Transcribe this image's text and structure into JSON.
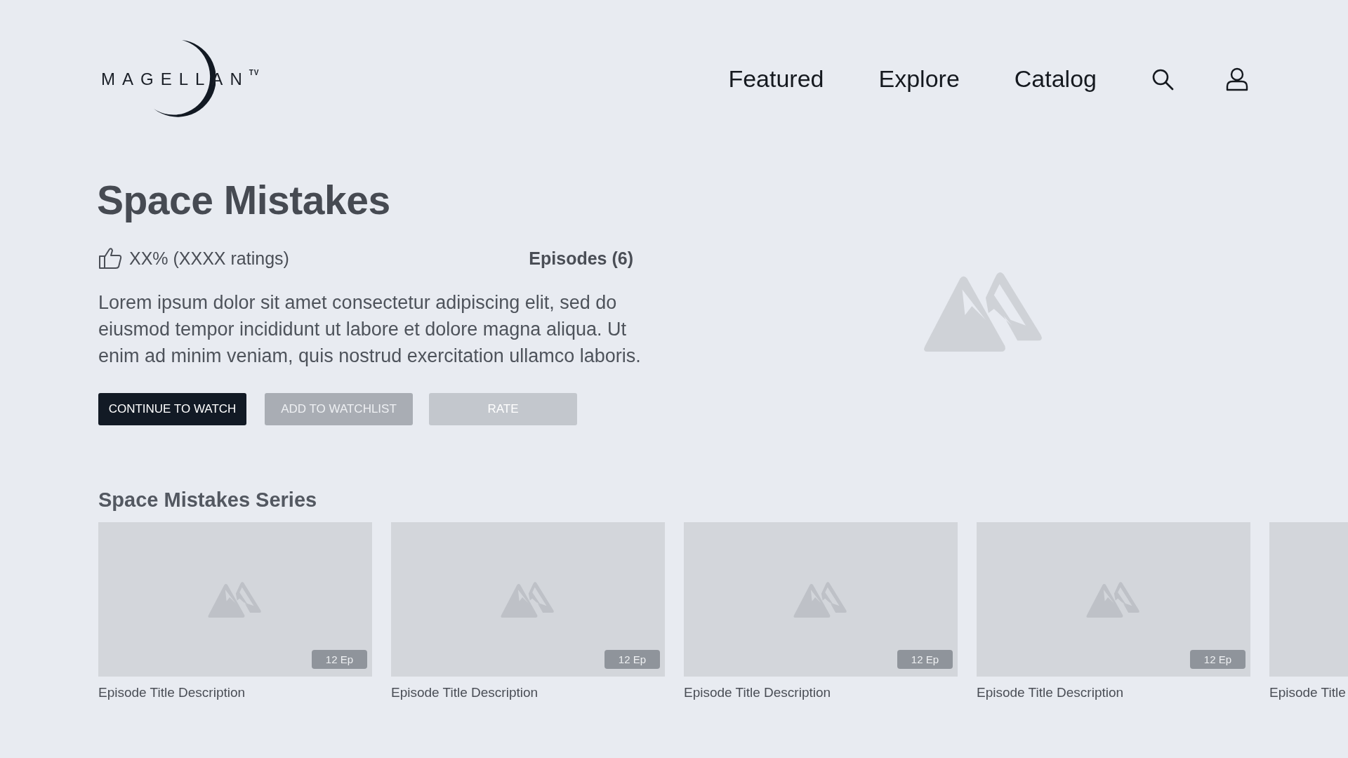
{
  "logo": {
    "text": "MAGELLAN$^{TV}$"
  },
  "nav": {
    "links": [
      {
        "label": "Featured"
      },
      {
        "label": "Explore"
      },
      {
        "label": "Catalog"
      }
    ]
  },
  "show": {
    "title": "Space Mistakes",
    "rating": "XX% (XXXX ratings)",
    "episodes": "Episodes (6)",
    "description": "Lorem ipsum dolor sit amet consectetur adipiscing elit, sed do eiusmod tempor incididunt ut labore et dolore magna aliqua. Ut enim ad minim veniam, quis nostrud exercitation ullamco laboris.",
    "buttons": [
      {
        "label": "CONTINUE TO WATCH",
        "kind": "primary",
        "disabled": false
      },
      {
        "label": "ADD TO WATCHLIST",
        "kind": "secondary",
        "disabled": false
      },
      {
        "label": "RATE",
        "kind": "secondary",
        "disabled": true
      }
    ]
  },
  "series": {
    "title": "Space Mistakes Series",
    "cards": [
      {
        "title": "Episode Title Description",
        "badge": "12 Ep"
      },
      {
        "title": "Episode Title Description",
        "badge": "12 Ep"
      },
      {
        "title": "Episode Title Description",
        "badge": "12 Ep"
      },
      {
        "title": "Episode Title Description",
        "badge": "12 Ep"
      },
      {
        "title": "Episode Title"
      }
    ]
  }
}
